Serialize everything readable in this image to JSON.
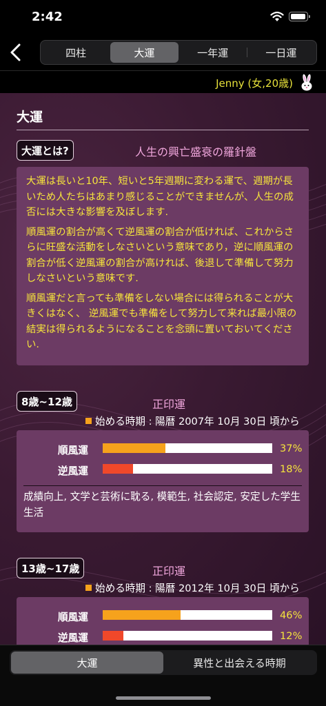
{
  "status": {
    "time": "2:42"
  },
  "nav": {
    "tabs": [
      {
        "label": "四柱",
        "active": false
      },
      {
        "label": "大運",
        "active": true
      },
      {
        "label": "一年運",
        "active": false
      },
      {
        "label": "一日運",
        "active": false
      }
    ]
  },
  "user": {
    "label": "Jenny (女,20歳)"
  },
  "section": {
    "title": "大運"
  },
  "intro": {
    "tag": "大運とは?",
    "heading": "人生の興亡盛衰の羅針盤",
    "paragraphs": [
      "大運は長いと10年、短いと5年週期に変わる運で、週期が長いため人たちはあまり感じることができませんが、人生の成否には大きな影響を及ぼします.",
      "順風運の割合が高くて逆風運の割合が低ければ、これからさらに旺盛な活動をしなさいという意味であり，逆に順風運の割合が低く逆風運の割合が高ければ、後退して準備して努力しなさいという意味です.",
      "順風運だと言っても準備をしない場合には得られることが大きくはなく、 逆風運でも準備をして努力して来れば最小限の結実は得られるようになることを念頭に置いておいてください."
    ]
  },
  "periods": [
    {
      "age": "8歳~12歳",
      "name": "正印運",
      "start": "始める時期 : 陽暦 2007年 10月 30日 頃から",
      "good_label": "順風運",
      "good_pct": 37,
      "good_text": "37%",
      "bad_label": "逆風運",
      "bad_pct": 18,
      "bad_text": "18%",
      "desc": "成績向上, 文学と芸術に耽る, 模範生, 社会認定, 安定した学生生活"
    },
    {
      "age": "13歳~17歳",
      "name": "正印運",
      "start": "始める時期 : 陽暦 2012年 10月 30日 頃から",
      "good_label": "順風運",
      "good_pct": 46,
      "good_text": "46%",
      "bad_label": "逆風運",
      "bad_pct": 12,
      "bad_text": "12%",
      "desc": ""
    }
  ],
  "bottom_tabs": [
    {
      "label": "大運",
      "active": true
    },
    {
      "label": "異性と出会える時期",
      "active": false
    }
  ],
  "colors": {
    "accent_yellow": "#f6e43c",
    "pink_heading": "#f0a6dc",
    "good_bar": "#f6a21c",
    "bad_bar": "#f0482a",
    "card": "#6c3b64"
  }
}
